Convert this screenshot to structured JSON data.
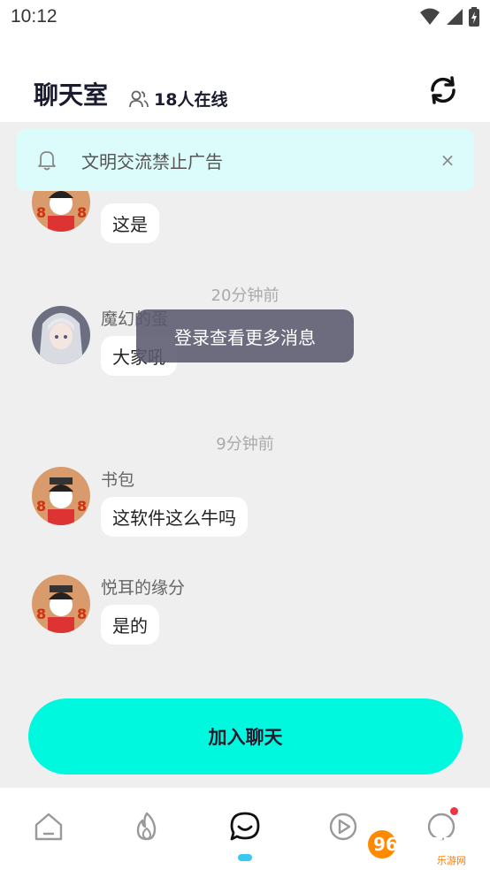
{
  "status_bar": {
    "time": "10:12"
  },
  "header": {
    "title": "聊天室",
    "online_text": "18人在线"
  },
  "notice": {
    "text": "文明交流禁止广告",
    "close": "×"
  },
  "messages": [
    {
      "name": "",
      "text": "这是"
    },
    {
      "time": "20分钟前"
    },
    {
      "name": "魔幻的蛋",
      "text": "大家吼"
    },
    {
      "time": "9分钟前"
    },
    {
      "name": "书包",
      "text": "这软件这么牛吗"
    },
    {
      "name": "悦耳的缘分",
      "text": "是的"
    }
  ],
  "toast": {
    "text": "登录查看更多消息"
  },
  "join_button": {
    "label": "加入聊天"
  },
  "bottom_nav": {
    "items": [
      "home-icon",
      "fire-icon",
      "chat-icon",
      "play-icon",
      "profile-icon"
    ],
    "active_index": 2
  },
  "watermark": {
    "brand": "962.NET",
    "sub": "乐游网"
  },
  "colors": {
    "accent": "#00f8de",
    "notice_bg": "#dcfbfb",
    "indicator": "#38c8f0",
    "badge": "#ee3344"
  }
}
